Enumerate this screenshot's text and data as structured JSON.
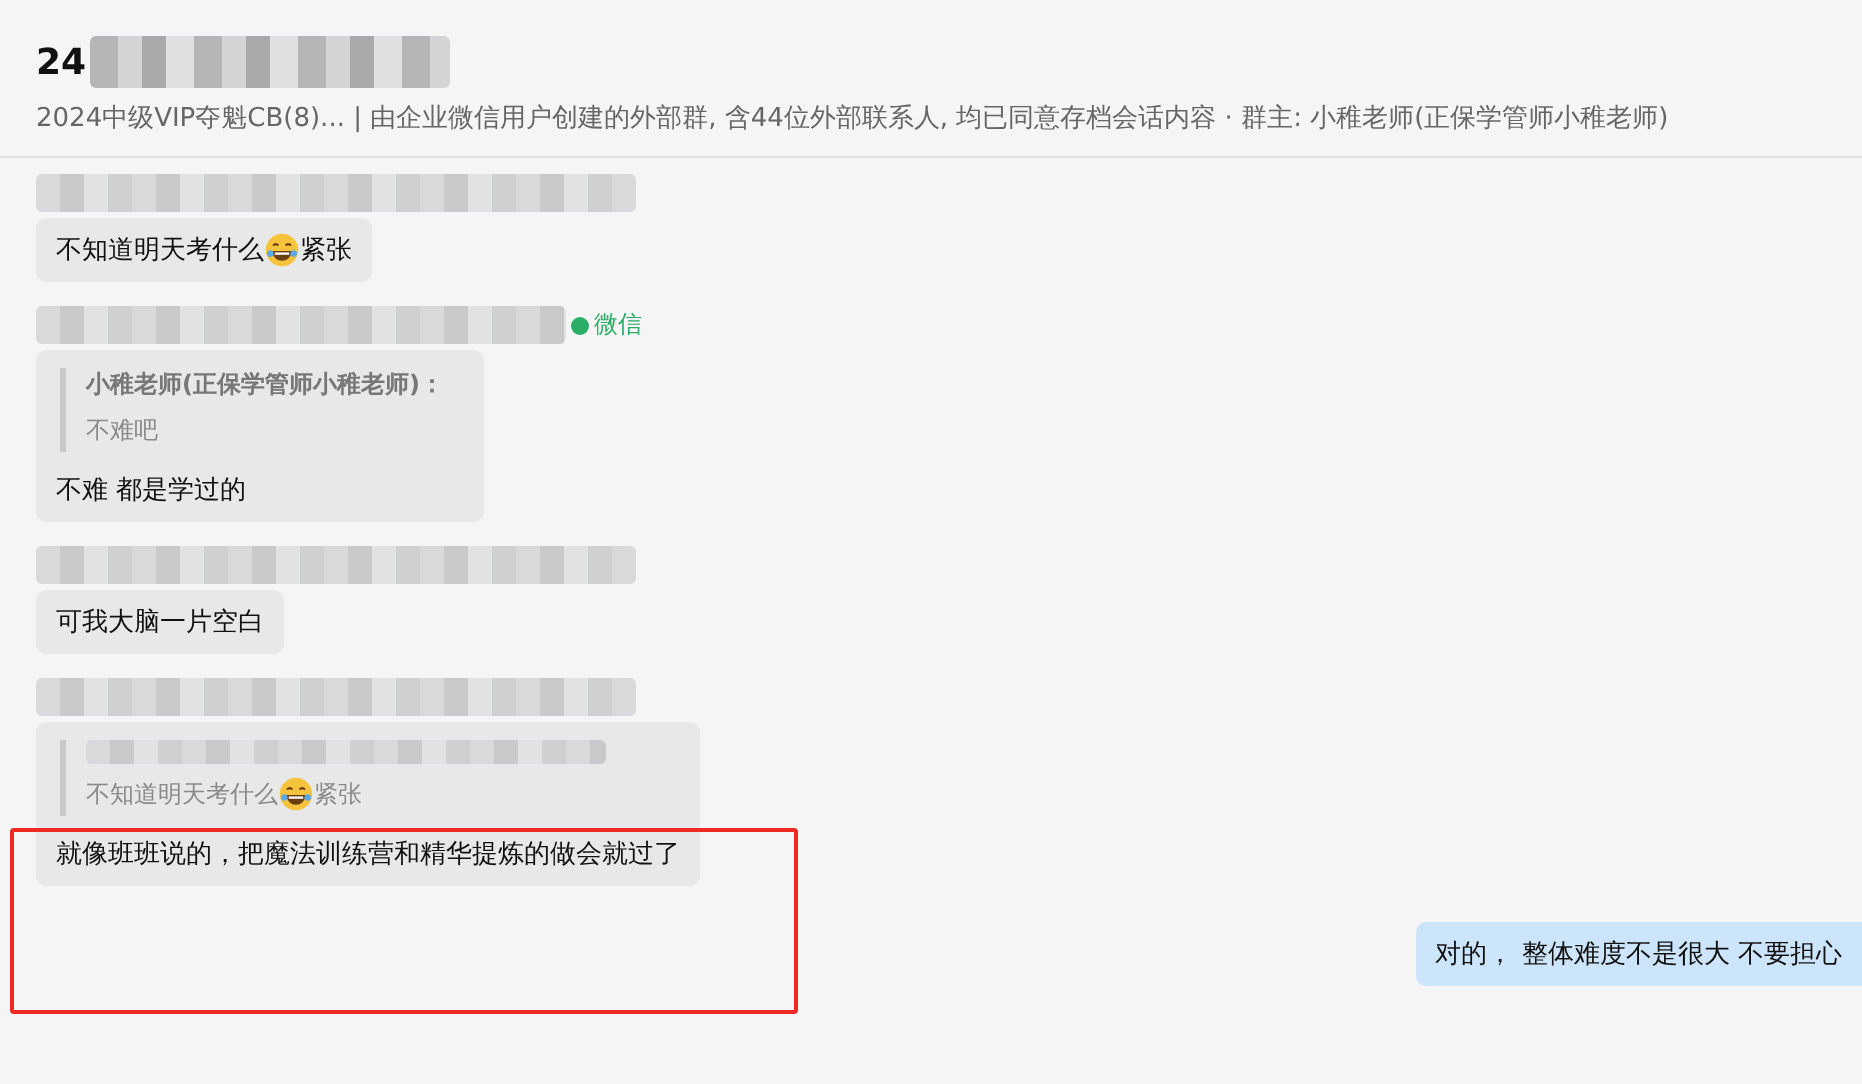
{
  "header": {
    "title": "24",
    "title_redacted": true,
    "subtitle": "2024中级VIP夺魁CB(8)... | 由企业微信用户创建的外部群, 含44位外部联系人, 均已同意存档会话内容  · 群主: 小稚老师(正保学管师小稚老师)"
  },
  "messages": [
    {
      "kind": "incoming",
      "sender_redacted": true,
      "segments": [
        {
          "kind": "text",
          "text": "不知道明天考什么"
        },
        {
          "kind": "emoji"
        },
        {
          "kind": "text",
          "text": "紧张"
        }
      ]
    },
    {
      "kind": "incoming",
      "sender_redacted": true,
      "sender_suffix": "微信",
      "quote": {
        "sender": "小稚老师(正保学管师小稚老师)：",
        "segments": [
          {
            "kind": "text",
            "text": "不难吧"
          }
        ]
      },
      "segments": [
        {
          "kind": "text",
          "text": "不难  都是学过的"
        }
      ]
    },
    {
      "kind": "incoming",
      "sender_redacted": true,
      "segments": [
        {
          "kind": "text",
          "text": "可我大脑一片空白"
        }
      ]
    },
    {
      "kind": "incoming",
      "sender_redacted": true,
      "highlighted": true,
      "quote": {
        "sender_redacted": true,
        "segments": [
          {
            "kind": "text",
            "text": "不知道明天考什么"
          },
          {
            "kind": "emoji"
          },
          {
            "kind": "text",
            "text": "紧张"
          }
        ]
      },
      "segments": [
        {
          "kind": "text",
          "text": "就像班班说的，把魔法训练营和精华提炼的做会就过了"
        }
      ]
    },
    {
      "kind": "outgoing",
      "segments": [
        {
          "kind": "text",
          "text": "对的， 整体难度不是很大 不要担心"
        }
      ]
    }
  ]
}
